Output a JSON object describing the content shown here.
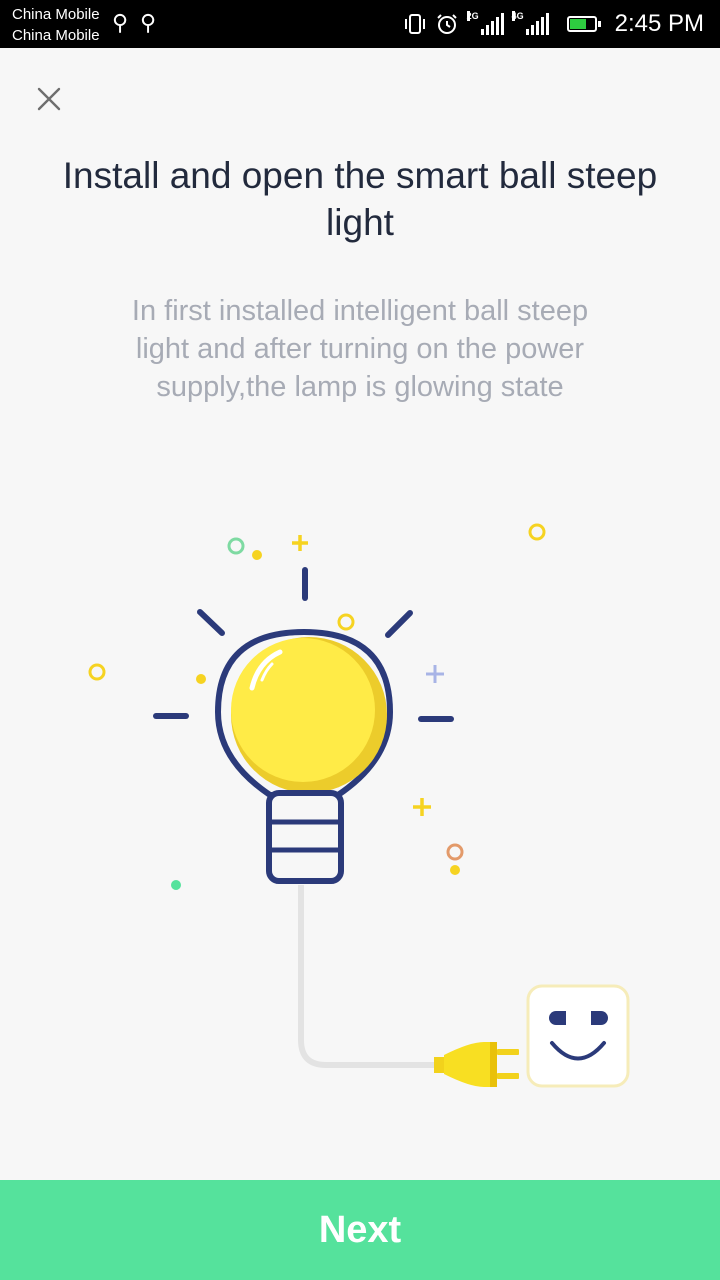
{
  "status_bar": {
    "carrier_1": "China Mobile",
    "carrier_2": "China Mobile",
    "network_1": "2G",
    "network_2": "4G",
    "time": "2:45 PM"
  },
  "header": {
    "close_icon": "close-icon"
  },
  "main": {
    "title": "Install and open the smart ball steep light",
    "description": "In first installed intelligent ball steep light and after turning on the power supply,the lamp is glowing state",
    "illustration_icons": [
      "lightbulb-icon",
      "plug-icon",
      "socket-icon"
    ]
  },
  "footer": {
    "next_label": "Next"
  },
  "colors": {
    "accent": "#55e29c",
    "bulb": "#ffeb47",
    "outline": "#2b3a7a",
    "title": "#222a3d",
    "description": "#a7abb5"
  }
}
